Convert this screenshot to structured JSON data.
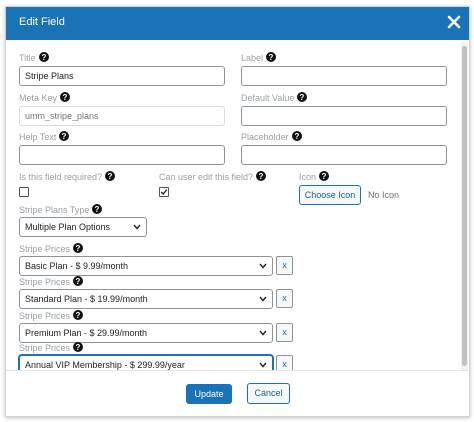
{
  "dialog": {
    "title": "Edit Field"
  },
  "fields": {
    "title": {
      "label": "Title",
      "value": "Stripe Plans"
    },
    "label": {
      "label": "Label",
      "value": ""
    },
    "meta_key": {
      "label": "Meta Key",
      "placeholder": "umm_stripe_plans"
    },
    "default_value": {
      "label": "Default Value",
      "value": ""
    },
    "help_text": {
      "label": "Help Text",
      "value": ""
    },
    "placeholder": {
      "label": "Placeholder",
      "value": ""
    },
    "required": {
      "label": "Is this field required?",
      "checked": false
    },
    "user_edit": {
      "label": "Can user edit this field?",
      "checked": true
    },
    "icon": {
      "label": "Icon",
      "button": "Choose Icon",
      "status": "No Icon"
    },
    "plans_type": {
      "label": "Stripe Plans Type",
      "value": "Multiple Plan Options"
    }
  },
  "prices": [
    {
      "label": "Stripe Prices",
      "value": "Basic Plan - $ 9.99/month",
      "remove": "x"
    },
    {
      "label": "Stripe Prices",
      "value": "Standard Plan - $ 19.99/month",
      "remove": "x"
    },
    {
      "label": "Stripe Prices",
      "value": "Premium Plan - $ 29.99/month",
      "remove": "x"
    },
    {
      "label": "Stripe Prices",
      "value": "Annual VIP Membership - $ 299.99/year",
      "remove": "x"
    }
  ],
  "footer": {
    "update": "Update",
    "cancel": "Cancel"
  },
  "colors": {
    "accent": "#1a73b6",
    "help_icon": "#111111"
  }
}
